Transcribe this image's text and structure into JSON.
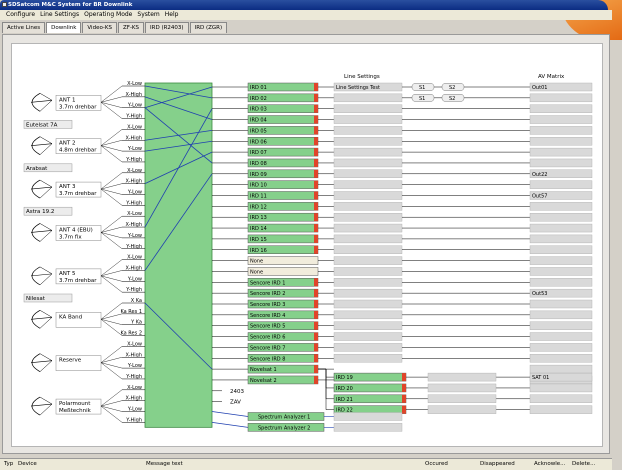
{
  "window": {
    "title": "SDSatcom M&C System for BR Downlink"
  },
  "menu": [
    "Configure",
    "Line Settings",
    "Operating Mode",
    "System",
    "Help"
  ],
  "tabs": [
    {
      "label": "Active Lines",
      "active": false
    },
    {
      "label": "Downlink",
      "active": true
    },
    {
      "label": "Video-KS",
      "active": false
    },
    {
      "label": "ZF-KS",
      "active": false
    },
    {
      "label": "IRD (R2403)",
      "active": false
    },
    {
      "label": "IRD (ZGR)",
      "active": false
    }
  ],
  "antennas": [
    {
      "name": "ANT 1",
      "sub": "3.7m drehbar",
      "group": "",
      "ports": [
        "X-Low",
        "X-High",
        "Y-Low",
        "Y-High"
      ]
    },
    {
      "name": "ANT 2",
      "sub": "4.8m drehbar",
      "group": "Eutelsat 7A",
      "ports": [
        "X-Low",
        "X-High",
        "Y-Low",
        "Y-High"
      ]
    },
    {
      "name": "ANT 3",
      "sub": "3.7m drehbar",
      "group": "Arabsat",
      "ports": [
        "X-Low",
        "X-High",
        "Y-Low",
        "Y-High"
      ]
    },
    {
      "name": "ANT 4 (EBU)",
      "sub": "3.7m fix",
      "group": "Astra 19.2",
      "ports": [
        "X-Low",
        "X-High",
        "Y-Low",
        "Y-High"
      ]
    },
    {
      "name": "ANT 5",
      "sub": "3.7m drehbar",
      "group": "",
      "ports": [
        "X-Low",
        "X-High",
        "Y-Low",
        "Y-High"
      ]
    },
    {
      "name": "KA Band",
      "sub": "",
      "group": "Nilesat",
      "ports": [
        "X Ka",
        "Ka Res 1",
        "Y Ka",
        "Ka Res 2"
      ]
    },
    {
      "name": "Reserve",
      "sub": "",
      "group": "",
      "ports": [
        "X-Low",
        "X-High",
        "Y-Low",
        "Y-High"
      ]
    },
    {
      "name": "Polarmount",
      "sub": "Meßtechnik",
      "group": "",
      "ports": [
        "X-Low",
        "X-High",
        "Y-Low",
        "Y-High"
      ]
    }
  ],
  "outputs": [
    "IRD 01",
    "IRD 02",
    "IRD 03",
    "IRD 04",
    "IRD 05",
    "IRD 06",
    "IRD 07",
    "IRD 08",
    "IRD 09",
    "IRD 10",
    "IRD 11",
    "IRD 12",
    "IRD 13",
    "IRD 14",
    "IRD 15",
    "IRD 16",
    "None",
    "None",
    "Sencore IRD 1",
    "Sencore IRD 2",
    "Sencore IRD 3",
    "Sencore IRD 4",
    "Sencore IRD 5",
    "Sencore IRD 6",
    "Sencore IRD 7",
    "Sencore IRD 8",
    "Novelsat 1",
    "Novelsat 2"
  ],
  "extra_labels": [
    "2403",
    "ZAV"
  ],
  "spectrum": [
    "Spectrum Analyzer 1",
    "Spectrum Analyzer 2"
  ],
  "novelsat_outputs": [
    "IRD 19",
    "IRD 20",
    "IRD 21",
    "IRD 22"
  ],
  "line_settings": {
    "header": "Line Settings",
    "first": "Line Settings Test",
    "switches": [
      "S1",
      "S2",
      "S1",
      "S2"
    ]
  },
  "av_matrix": {
    "header": "AV Matrix",
    "entries": {
      "0": "Out01",
      "8": "Out22",
      "10": "Out57",
      "19": "Out53"
    },
    "sat": "SAT 01"
  },
  "status_columns": [
    "Typ",
    "Device",
    "Message text",
    "Occured",
    "Disappeared",
    "Acknowle...",
    "Delete..."
  ],
  "colors": {
    "box": "#85d08b",
    "red": "#e0452a",
    "line": "#1f3fb0",
    "title": "#0b2c83",
    "orange": "#e46a14"
  }
}
